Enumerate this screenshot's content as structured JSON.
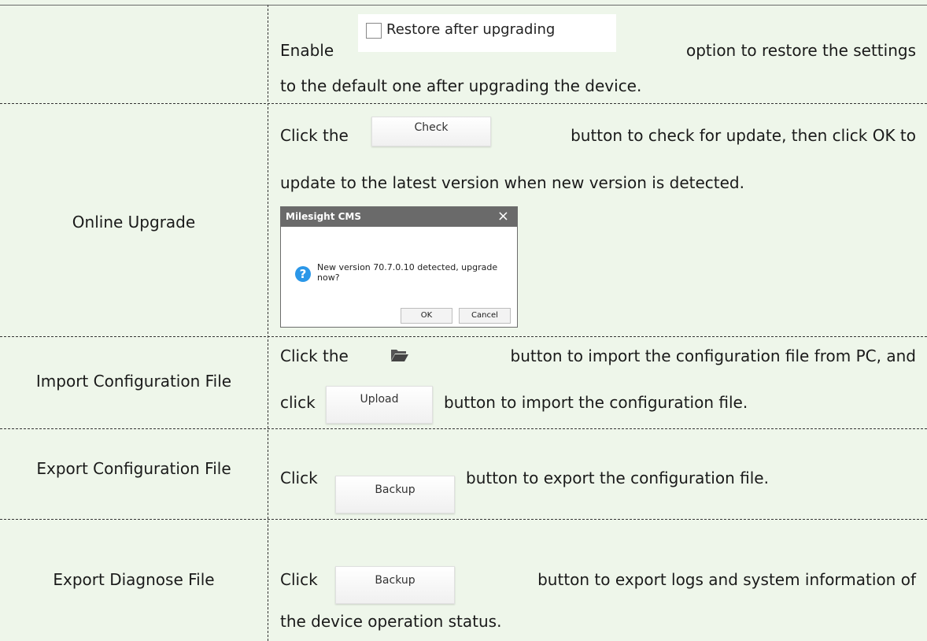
{
  "restore": {
    "checkbox_label": "Restore after upgrading",
    "line1_before": "Enable",
    "line1_after": "option to restore the settings",
    "line2": "to the default one after upgrading the device."
  },
  "online_upgrade": {
    "label": "Online Upgrade",
    "line1_before": "Click the",
    "button": "Check",
    "line1_after": "button to check for update, then click OK to",
    "line2": "update to the latest version when new version is detected.",
    "dialog": {
      "title": "Milesight CMS",
      "close": "×",
      "message": "New version 70.7.0.10 detected, upgrade now?",
      "ok": "OK",
      "cancel": "Cancel"
    }
  },
  "import_config": {
    "label": "Import Configuration File",
    "line1_before": "Click the",
    "line1_after": "button to import the configuration file from PC, and",
    "line2_before": "click",
    "button": "Upload",
    "line2_after": "button to import the configuration file."
  },
  "export_config": {
    "label": "Export Configuration File",
    "line_before": "Click",
    "button": "Backup",
    "line_after": "button to export the configuration file."
  },
  "export_diagnose": {
    "label": "Export Diagnose File",
    "line1_before": "Click",
    "button": "Backup",
    "line1_after": "button to export logs and system information of",
    "line2": "the device operation status."
  },
  "icons": {
    "folder": "folder-open-icon",
    "question": "question-icon"
  },
  "colors": {
    "background": "#eef6ea",
    "dialog_titlebar": "#6a6a6a",
    "question_icon": "#2b97e8"
  }
}
